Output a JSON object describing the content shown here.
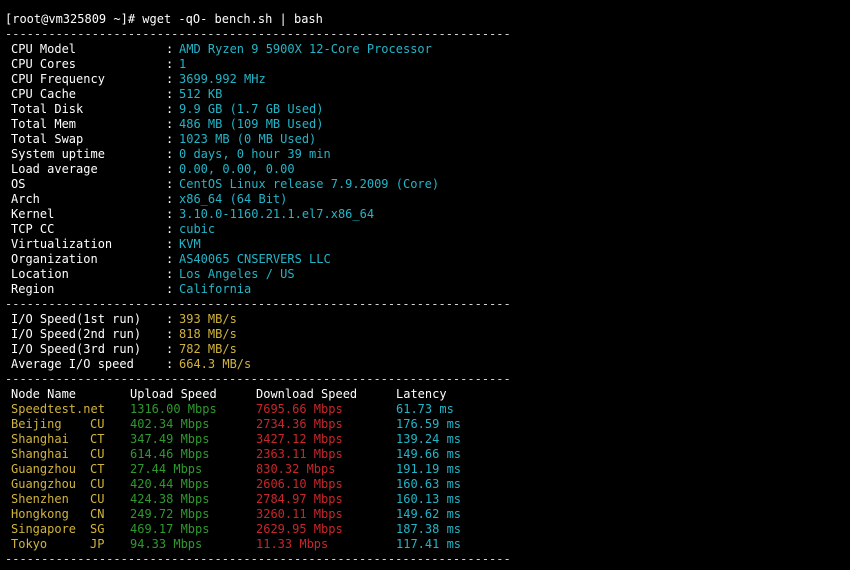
{
  "prompt": "[root@vm325809 ~]# wget -qO- bench.sh | bash",
  "divider": "----------------------------------------------------------------------",
  "system_info": [
    {
      "label": "CPU Model",
      "value": "AMD Ryzen 9 5900X 12-Core Processor"
    },
    {
      "label": "CPU Cores",
      "value": "1"
    },
    {
      "label": "CPU Frequency",
      "value": "3699.992 MHz"
    },
    {
      "label": "CPU Cache",
      "value": "512 KB"
    },
    {
      "label": "Total Disk",
      "value": "9.9 GB (1.7 GB Used)"
    },
    {
      "label": "Total Mem",
      "value": "486 MB (109 MB Used)"
    },
    {
      "label": "Total Swap",
      "value": "1023 MB (0 MB Used)"
    },
    {
      "label": "System uptime",
      "value": "0 days, 0 hour 39 min"
    },
    {
      "label": "Load average",
      "value": "0.00, 0.00, 0.00"
    },
    {
      "label": "OS",
      "value": "CentOS Linux release 7.9.2009 (Core)"
    },
    {
      "label": "Arch",
      "value": "x86_64 (64 Bit)"
    },
    {
      "label": "Kernel",
      "value": "3.10.0-1160.21.1.el7.x86_64"
    },
    {
      "label": "TCP CC",
      "value": "cubic"
    },
    {
      "label": "Virtualization",
      "value": "KVM"
    },
    {
      "label": "Organization",
      "value": "AS40065 CNSERVERS LLC"
    },
    {
      "label": "Location",
      "value": "Los Angeles / US"
    },
    {
      "label": "Region",
      "value": "California"
    }
  ],
  "io_speed": [
    {
      "label": "I/O Speed(1st run)",
      "value": "393 MB/s"
    },
    {
      "label": "I/O Speed(2nd run)",
      "value": "818 MB/s"
    },
    {
      "label": "I/O Speed(3rd run)",
      "value": "782 MB/s"
    },
    {
      "label": "Average I/O speed",
      "value": "664.3 MB/s"
    }
  ],
  "speedtest": {
    "headers": {
      "node": "Node Name",
      "upload": "Upload Speed",
      "download": "Download Speed",
      "latency": "Latency"
    },
    "rows": [
      {
        "node": "Speedtest.net",
        "isp": "",
        "upload": "1316.00 Mbps",
        "download": "7695.66 Mbps",
        "latency": "61.73 ms"
      },
      {
        "node": "Beijing",
        "isp": "CU",
        "upload": "402.34 Mbps",
        "download": "2734.36 Mbps",
        "latency": "176.59 ms"
      },
      {
        "node": "Shanghai",
        "isp": "CT",
        "upload": "347.49 Mbps",
        "download": "3427.12 Mbps",
        "latency": "139.24 ms"
      },
      {
        "node": "Shanghai",
        "isp": "CU",
        "upload": "614.46 Mbps",
        "download": "2363.11 Mbps",
        "latency": "149.66 ms"
      },
      {
        "node": "Guangzhou",
        "isp": "CT",
        "upload": "27.44 Mbps",
        "download": "830.32 Mbps",
        "latency": "191.19 ms"
      },
      {
        "node": "Guangzhou",
        "isp": "CU",
        "upload": "420.44 Mbps",
        "download": "2606.10 Mbps",
        "latency": "160.63 ms"
      },
      {
        "node": "Shenzhen",
        "isp": "CU",
        "upload": "424.38 Mbps",
        "download": "2784.97 Mbps",
        "latency": "160.13 ms"
      },
      {
        "node": "Hongkong",
        "isp": "CN",
        "upload": "249.72 Mbps",
        "download": "3260.11 Mbps",
        "latency": "149.62 ms"
      },
      {
        "node": "Singapore",
        "isp": "SG",
        "upload": "469.17 Mbps",
        "download": "2629.95 Mbps",
        "latency": "187.38 ms"
      },
      {
        "node": "Tokyo",
        "isp": "JP",
        "upload": "94.33 Mbps",
        "download": "11.33 Mbps",
        "latency": "117.41 ms"
      }
    ]
  },
  "colors": {
    "background": "#000000",
    "value_cyan": "#23b5c8",
    "io_yellow": "#d2b43c",
    "upload_green": "#2e9a2e",
    "download_red": "#c8262a"
  }
}
